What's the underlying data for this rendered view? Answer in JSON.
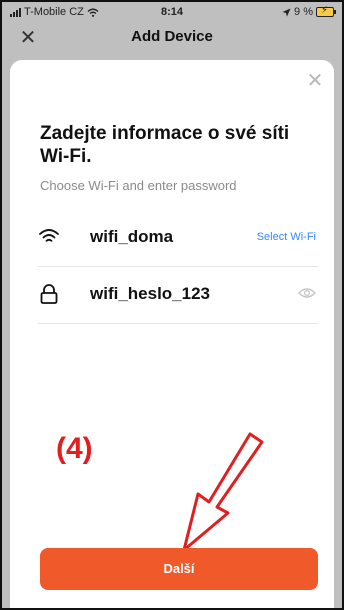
{
  "status_bar": {
    "carrier": "T-Mobile CZ",
    "time": "8:14",
    "battery": "9 %",
    "icons": [
      "signal-icon",
      "wifi-icon",
      "location-icon",
      "battery-charging-icon"
    ]
  },
  "nav": {
    "title": "Add Device",
    "close_icon": "close-icon"
  },
  "sheet": {
    "close_icon": "close-icon",
    "heading": "Zadejte informace o své síti Wi-Fi.",
    "subheading": "Choose Wi-Fi and enter password",
    "wifi_row": {
      "icon": "wifi-icon",
      "value": "wifi_doma",
      "action_label": "Select Wi-Fi"
    },
    "password_row": {
      "icon": "lock-icon",
      "value": "wifi_heslo_123",
      "action_icon": "eye-icon"
    },
    "annotation": "(4)",
    "next_button": "Další"
  },
  "colors": {
    "accent": "#f05a2a",
    "link": "#3a86ff",
    "annotation": "#e02020",
    "overlay": "#bfbfbf"
  }
}
